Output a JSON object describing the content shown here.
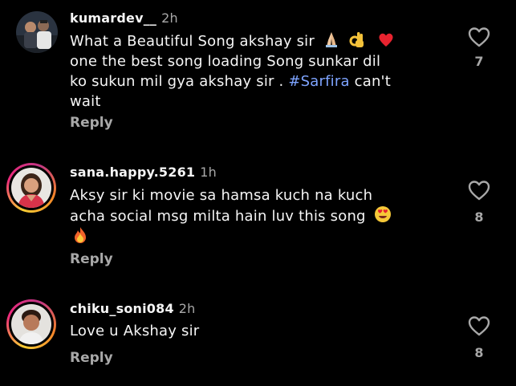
{
  "comments": [
    {
      "username": "kumardev__",
      "time": "2h",
      "text_parts": {
        "line1": "What a Beautiful Song akshay sir",
        "line2": "one the best song loading Song sunkar dil",
        "line3_a": "ko sukun mil gya akshay sir . ",
        "hashtag": "#Sarfira",
        "line3_b": " can't",
        "line4": "wait"
      },
      "emojis": [
        "folded-hands",
        "ok-hand",
        "red-heart"
      ],
      "reply_label": "Reply",
      "likes": "7"
    },
    {
      "username": "sana.happy.5261",
      "time": "1h",
      "text_parts": {
        "line1": "Aksy  sir ki movie sa hamsa kuch na kuch",
        "line2": "acha social msg milta hain luv this song"
      },
      "emojis": [
        "heart-eyes",
        "fire"
      ],
      "reply_label": "Reply",
      "likes": "8"
    },
    {
      "username": "chiku_soni084",
      "time": "2h",
      "text_parts": {
        "line1": "Love u Akshay sir"
      },
      "emojis": [],
      "reply_label": "Reply",
      "likes": "8"
    }
  ],
  "colors": {
    "background": "#000000",
    "primary_text": "#f5f5f5",
    "secondary_text": "#a8a8a8",
    "hashtag": "#7ea4ff",
    "story_ring": "#ee2a7b"
  }
}
